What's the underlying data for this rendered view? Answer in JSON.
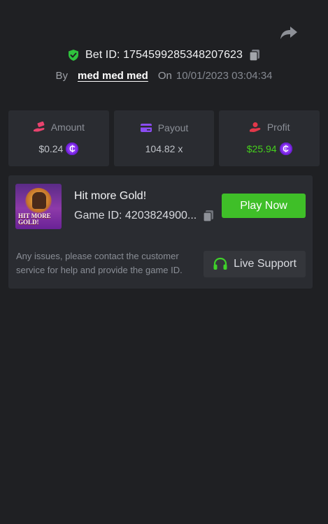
{
  "header": {
    "share_icon": "share-arrow-icon",
    "verified_icon": "shield-check-icon",
    "bet_id": "Bet ID: 1754599285348207623",
    "copy_icon": "copy-icon",
    "by_label": "By",
    "username": "med med med",
    "on_label": "On",
    "timestamp": "10/01/2023 03:04:34"
  },
  "stats": {
    "amount": {
      "label": "Amount",
      "value": "$0.24",
      "icon": "hand-money-icon",
      "coin": "₵"
    },
    "payout": {
      "label": "Payout",
      "value": "104.82 x",
      "icon": "card-icon"
    },
    "profit": {
      "label": "Profit",
      "value": "$25.94",
      "icon": "profit-hand-icon",
      "coin": "₵"
    }
  },
  "game": {
    "thumbnail_text": "HIT MORE GOLD!",
    "title": "Hit more Gold!",
    "game_id": "Game ID: 4203824900...",
    "play_label": "Play Now",
    "issues_text": "Any issues, please contact the customer service for help and provide the game ID.",
    "support_label": "Live Support",
    "support_icon": "headset-icon"
  },
  "colors": {
    "background": "#1f2023",
    "card": "#2a2c31",
    "accent_green": "#3fbf28",
    "profit_green": "#45d11c",
    "coin_purple": "#8a34f0",
    "shield_green": "#2fc23d"
  }
}
